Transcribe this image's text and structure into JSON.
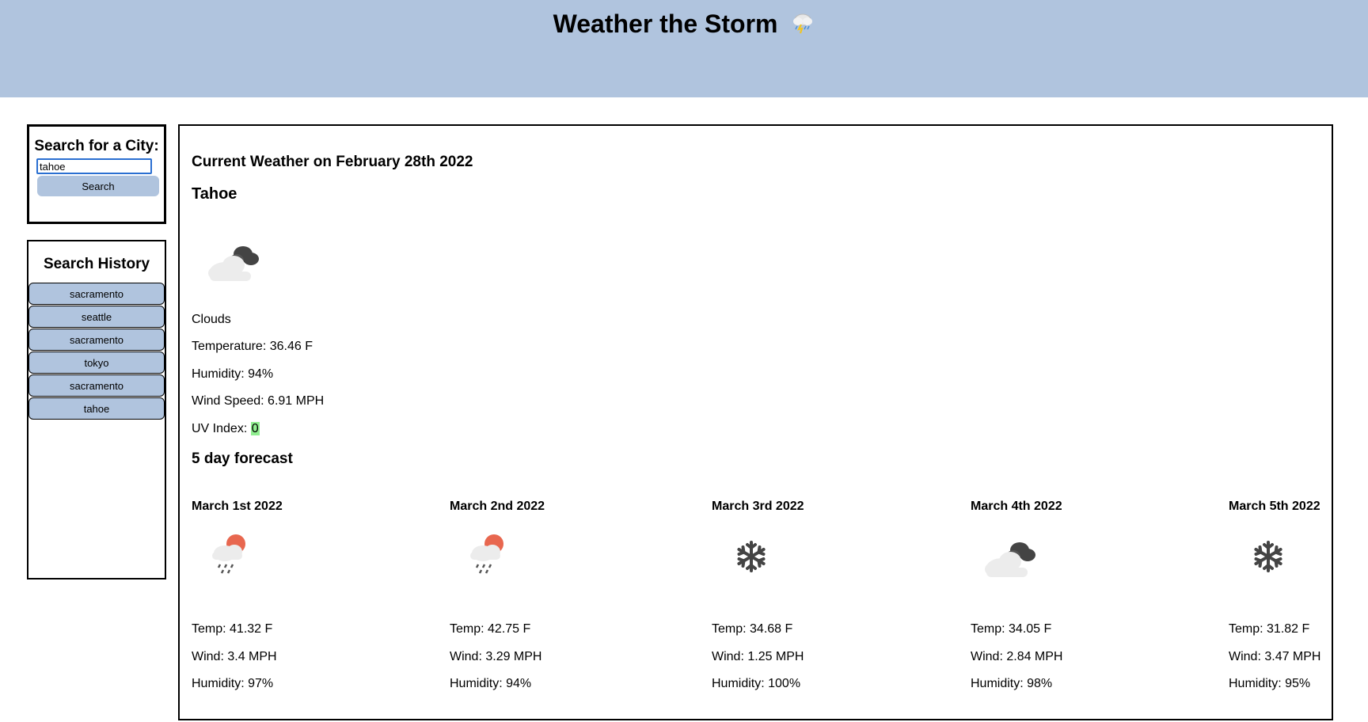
{
  "header": {
    "title": "Weather the Storm",
    "title_icon": "thunder-cloud-icon",
    "bg_color": "#b0c4de"
  },
  "search": {
    "heading": "Search for a City:",
    "input_value": "tahoe",
    "button_label": "Search"
  },
  "history": {
    "heading": "Search History",
    "items": [
      {
        "label": "sacramento"
      },
      {
        "label": "seattle"
      },
      {
        "label": "sacramento"
      },
      {
        "label": "tokyo"
      },
      {
        "label": "sacramento"
      },
      {
        "label": "tahoe"
      }
    ]
  },
  "current": {
    "heading": "Current Weather on February 28th 2022",
    "city": "Tahoe",
    "icon": "broken-clouds-icon",
    "description": "Clouds",
    "temperature": "Temperature: 36.46 F",
    "humidity": "Humidity: 94%",
    "wind": "Wind Speed: 6.91 MPH",
    "uv_label": "UV Index: ",
    "uv_value": "0",
    "uv_color": "#90ee90"
  },
  "forecast": {
    "heading": "5 day forecast",
    "days": [
      {
        "date": "March 1st 2022",
        "icon": "rain-sun-icon",
        "temp": "Temp: 41.32 F",
        "wind": "Wind: 3.4 MPH",
        "humidity": "Humidity: 97%"
      },
      {
        "date": "March 2nd 2022",
        "icon": "rain-sun-icon",
        "temp": "Temp: 42.75 F",
        "wind": "Wind: 3.29 MPH",
        "humidity": "Humidity: 94%"
      },
      {
        "date": "March 3rd 2022",
        "icon": "snowflake-icon",
        "temp": "Temp: 34.68 F",
        "wind": "Wind: 1.25 MPH",
        "humidity": "Humidity: 100%"
      },
      {
        "date": "March 4th 2022",
        "icon": "broken-clouds-icon",
        "temp": "Temp: 34.05 F",
        "wind": "Wind: 2.84 MPH",
        "humidity": "Humidity: 98%"
      },
      {
        "date": "March 5th 2022",
        "icon": "snowflake-icon",
        "temp": "Temp: 31.82 F",
        "wind": "Wind: 3.47 MPH",
        "humidity": "Humidity: 95%"
      }
    ]
  }
}
